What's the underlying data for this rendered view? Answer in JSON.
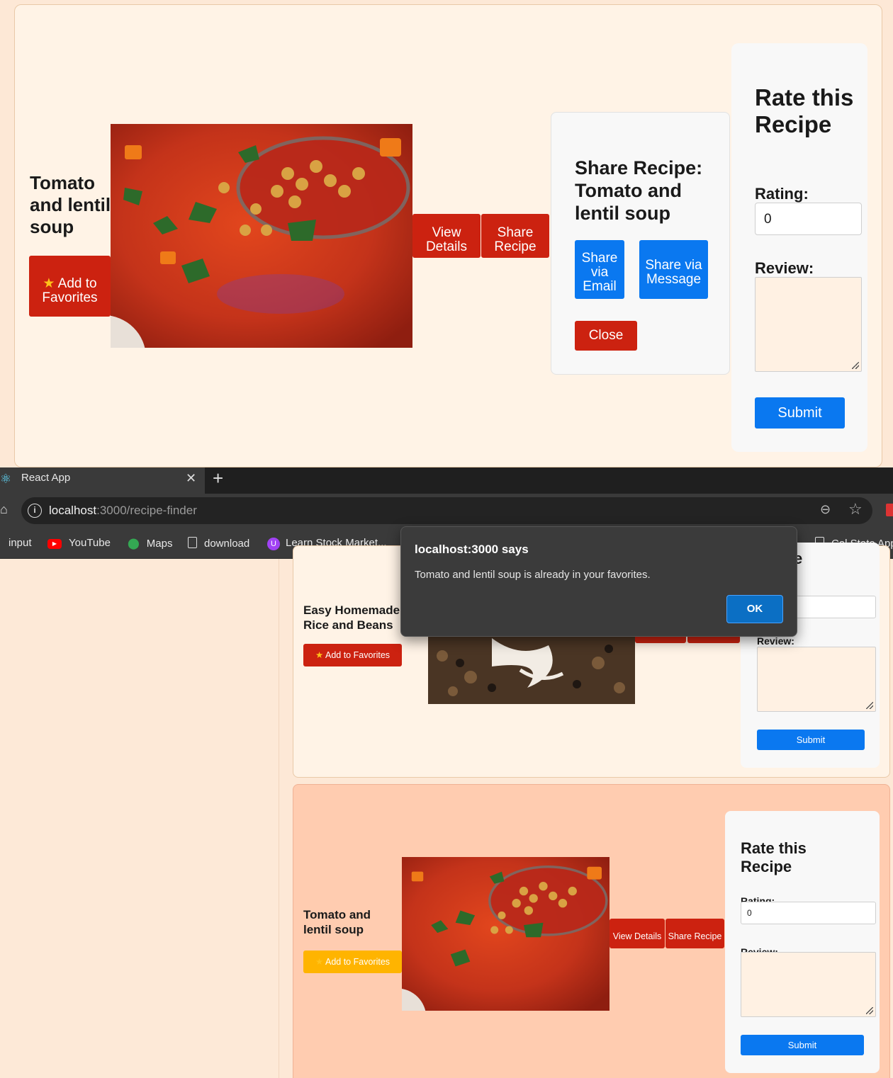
{
  "top_card": {
    "recipe_title": "Tomato and lentil soup",
    "add_favorites": "Add to Favorites",
    "view_details": "View Details",
    "share_recipe": "Share Recipe",
    "share_panel": {
      "title": "Share Recipe: Tomato and lentil soup",
      "share_email": "Share via Email",
      "share_message": "Share via Message",
      "close": "Close"
    },
    "rate": {
      "title": "Rate this Recipe",
      "rating_label": "Rating:",
      "rating_value": "0",
      "review_label": "Review:",
      "submit": "Submit"
    }
  },
  "browser": {
    "tab_title": "React App",
    "url_host": "localhost",
    "url_path": ":3000/recipe-finder",
    "bookmarks": [
      "input",
      "YouTube",
      "Maps",
      "download",
      "Learn Stock Market...",
      "Cal State App"
    ]
  },
  "dialog": {
    "title": "localhost:3000 says",
    "message": "Tomato and lentil soup is already in your favorites.",
    "ok": "OK"
  },
  "card2": {
    "recipe_title": "Easy Homemade Rice and Beans",
    "add_favorites": "Add to Favorites",
    "rate_title_partial": "e",
    "review_label": "Review:",
    "submit": "Submit"
  },
  "card3": {
    "recipe_title": "Tomato and lentil soup",
    "add_favorites": "Add to Favorites",
    "view_details": "View Details",
    "share_recipe": "Share Recipe",
    "rate": {
      "title": "Rate this Recipe",
      "rating_label": "Rating:",
      "rating_value": "0",
      "review_label": "Review:",
      "submit": "Submit"
    }
  },
  "colors": {
    "red_button": "#cc2210",
    "blue_button": "#0a78f0",
    "favorite_active": "#ffb400"
  }
}
